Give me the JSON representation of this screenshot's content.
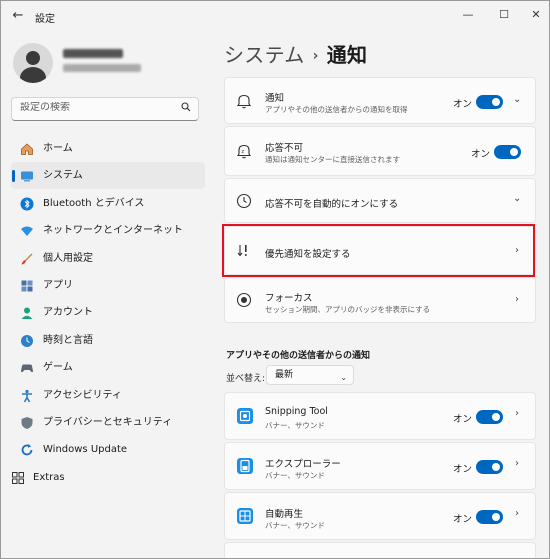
{
  "window": {
    "title": "設定",
    "minimize_glyph": "—",
    "maximize_glyph": "☐",
    "close_glyph": "✕",
    "back_glyph": "←"
  },
  "search": {
    "placeholder": "設定の検索"
  },
  "nav": {
    "items": [
      {
        "label": "ホーム",
        "icon": "home-icon"
      },
      {
        "label": "システム",
        "icon": "system-icon",
        "active": true
      },
      {
        "label": "Bluetooth とデバイス",
        "icon": "bluetooth-icon"
      },
      {
        "label": "ネットワークとインターネット",
        "icon": "network-icon"
      },
      {
        "label": "個人用設定",
        "icon": "brush-icon"
      },
      {
        "label": "アプリ",
        "icon": "apps-icon"
      },
      {
        "label": "アカウント",
        "icon": "account-icon"
      },
      {
        "label": "時刻と言語",
        "icon": "globe-clock-icon"
      },
      {
        "label": "ゲーム",
        "icon": "game-icon"
      },
      {
        "label": "アクセシビリティ",
        "icon": "accessibility-icon"
      },
      {
        "label": "プライバシーとセキュリティ",
        "icon": "shield-icon"
      },
      {
        "label": "Windows Update",
        "icon": "update-icon"
      }
    ],
    "extras_label": "Extras"
  },
  "breadcrumb": {
    "parent": "システム",
    "separator": "›",
    "current": "通知"
  },
  "cards": {
    "notifications": {
      "title": "通知",
      "subtitle": "アプリやその他の送信者からの通知を取得",
      "toggle": "オン"
    },
    "dnd": {
      "title": "応答不可",
      "subtitle": "通知は通知センターに直接送信されます",
      "toggle": "オン"
    },
    "dnd_auto": {
      "title": "応答不可を自動的にオンにする"
    },
    "priority": {
      "title": "優先通知を設定する"
    },
    "focus": {
      "title": "フォーカス",
      "subtitle": "セッション期間、アプリのバッジを非表示にする"
    }
  },
  "apps_section": {
    "heading": "アプリやその他の送信者からの通知",
    "sort_label": "並べ替え:",
    "sort_value": "最新",
    "apps": [
      {
        "name": "Snipping Tool",
        "subtitle": "バナー、サウンド",
        "toggle": "オン"
      },
      {
        "name": "エクスプローラー",
        "subtitle": "バナー、サウンド",
        "toggle": "オン"
      },
      {
        "name": "自動再生",
        "subtitle": "バナー、サウンド",
        "toggle": "オン"
      }
    ]
  },
  "colors": {
    "accent": "#0067c0",
    "highlight": "#e1131f"
  }
}
